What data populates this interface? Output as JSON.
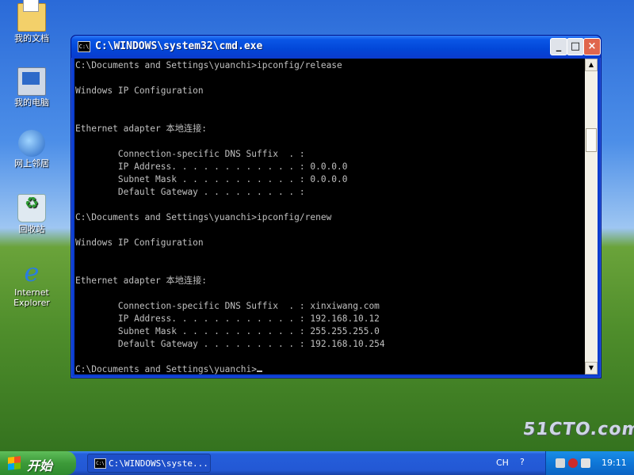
{
  "desktop": {
    "icons": [
      {
        "label": "我的文档",
        "icon": "my-documents-icon"
      },
      {
        "label": "我的电脑",
        "icon": "my-computer-icon"
      },
      {
        "label": "网上邻居",
        "icon": "network-places-icon"
      },
      {
        "label": "回收站",
        "icon": "recycle-bin-icon"
      },
      {
        "label": "Internet Explorer",
        "icon": "internet-explorer-icon"
      }
    ]
  },
  "window": {
    "title": "C:\\WINDOWS\\system32\\cmd.exe",
    "icon_glyph": "C:\\",
    "buttons": {
      "minimize": "_",
      "maximize": "□",
      "close": "×"
    }
  },
  "console": {
    "lines": [
      "C:\\Documents and Settings\\yuanchi>ipconfig/release",
      "",
      "Windows IP Configuration",
      "",
      "",
      "Ethernet adapter 本地连接:",
      "",
      "        Connection-specific DNS Suffix  . :",
      "        IP Address. . . . . . . . . . . . : 0.0.0.0",
      "        Subnet Mask . . . . . . . . . . . : 0.0.0.0",
      "        Default Gateway . . . . . . . . . :",
      "",
      "C:\\Documents and Settings\\yuanchi>ipconfig/renew",
      "",
      "Windows IP Configuration",
      "",
      "",
      "Ethernet adapter 本地连接:",
      "",
      "        Connection-specific DNS Suffix  . : xinxiwang.com",
      "        IP Address. . . . . . . . . . . . : 192.168.10.12",
      "        Subnet Mask . . . . . . . . . . . : 255.255.255.0",
      "        Default Gateway . . . . . . . . . : 192.168.10.254",
      "",
      "C:\\Documents and Settings\\yuanchi>"
    ]
  },
  "taskbar": {
    "start_label": "开始",
    "task_label": "C:\\WINDOWS\\syste...",
    "language": "CH",
    "clock": "19:11"
  },
  "watermark": "51CTO.com"
}
